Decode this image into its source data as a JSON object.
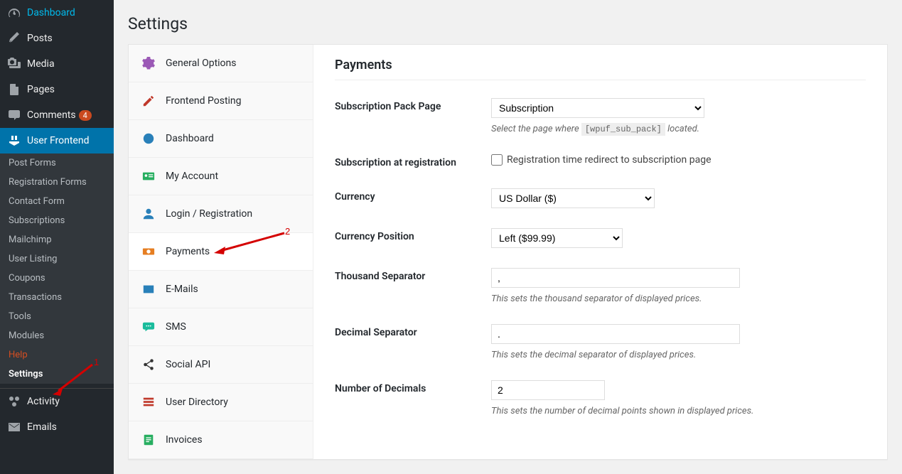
{
  "admin_menu": {
    "dashboard": "Dashboard",
    "posts": "Posts",
    "media": "Media",
    "pages": "Pages",
    "comments": "Comments",
    "comments_badge": "4",
    "user_frontend": "User Frontend",
    "activity": "Activity",
    "emails": "Emails"
  },
  "submenu": {
    "post_forms": "Post Forms",
    "registration_forms": "Registration Forms",
    "contact_form": "Contact Form",
    "subscriptions": "Subscriptions",
    "mailchimp": "Mailchimp",
    "user_listing": "User Listing",
    "coupons": "Coupons",
    "transactions": "Transactions",
    "tools": "Tools",
    "modules": "Modules",
    "help": "Help",
    "settings": "Settings"
  },
  "page": {
    "title": "Settings"
  },
  "tabs": {
    "general": "General Options",
    "frontend_posting": "Frontend Posting",
    "dashboard": "Dashboard",
    "my_account": "My Account",
    "login": "Login / Registration",
    "payments": "Payments",
    "emails": "E-Mails",
    "sms": "SMS",
    "social": "Social API",
    "user_directory": "User Directory",
    "invoices": "Invoices"
  },
  "content": {
    "section_title": "Payments",
    "sub_pack_label": "Subscription Pack Page",
    "sub_pack_value": "Subscription",
    "sub_pack_desc_pre": "Select the page where ",
    "sub_pack_code": "[wpuf_sub_pack]",
    "sub_pack_desc_post": " located.",
    "sub_reg_label": "Subscription at registration",
    "sub_reg_checkbox": "Registration time redirect to subscription page",
    "currency_label": "Currency",
    "currency_value": "US Dollar ($)",
    "currency_pos_label": "Currency Position",
    "currency_pos_value": "Left ($99.99)",
    "thousand_label": "Thousand Separator",
    "thousand_value": ",",
    "thousand_desc": "This sets the thousand separator of displayed prices.",
    "decimal_label": "Decimal Separator",
    "decimal_value": ".",
    "decimal_desc": "This sets the decimal separator of displayed prices.",
    "numdec_label": "Number of Decimals",
    "numdec_value": "2",
    "numdec_desc": "This sets the number of decimal points shown in displayed prices."
  },
  "annotations": {
    "num1": "1",
    "num2": "2"
  }
}
